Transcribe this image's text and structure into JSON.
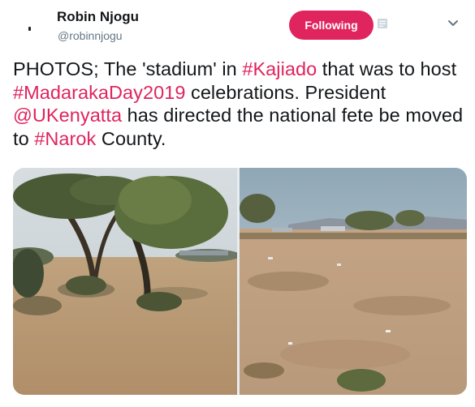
{
  "user": {
    "name": "Robin Njogu",
    "handle": "@robinnjogu"
  },
  "follow_button": {
    "label": "Following"
  },
  "icons": {
    "avatar": "avatar-icon",
    "block": "block-icon",
    "menu": "chevron-down-icon"
  },
  "tweet": {
    "seg1": "PHOTOS; The 'stadium' in ",
    "tag1": "#Kajiado",
    "seg2": " that was to host ",
    "tag2": "#MadarakaDay2019",
    "seg3": " celebrations. President ",
    "mention1": "@UKenyatta",
    "seg4": " has directed the national fete be moved to ",
    "tag3": "#Narok",
    "seg5": " County."
  },
  "colors": {
    "accent": "#e0245e",
    "text": "#14171a",
    "secondary": "#657786"
  }
}
